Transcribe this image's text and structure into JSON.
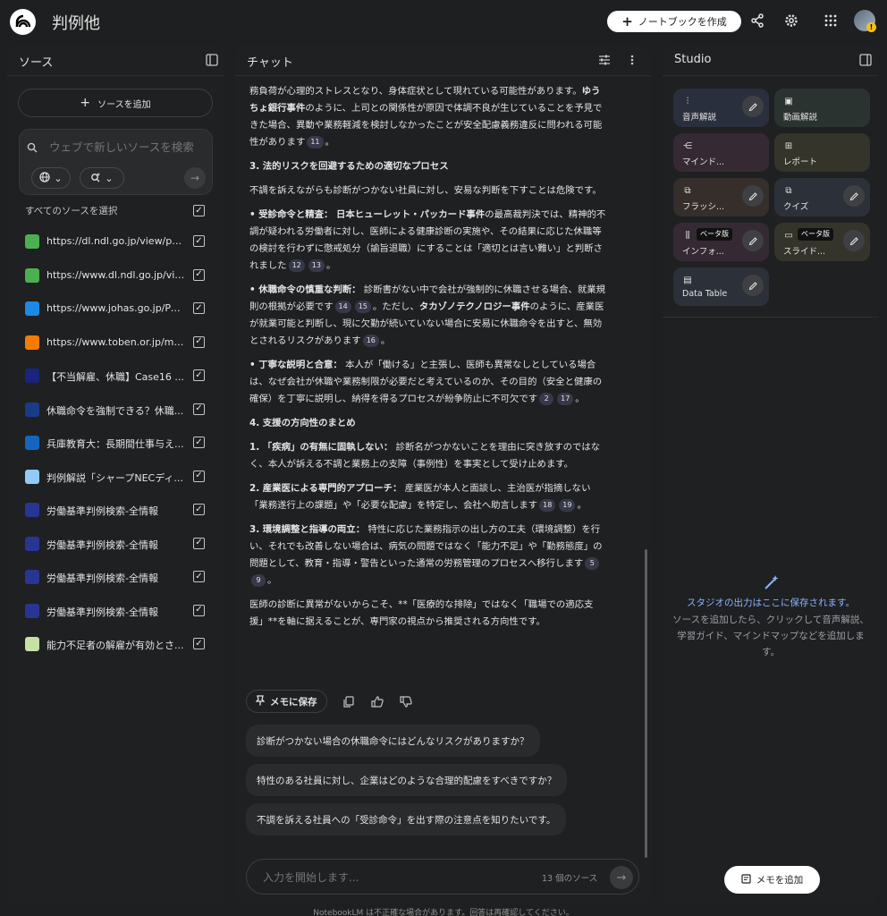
{
  "header": {
    "notebook_title": "判例他",
    "create_button": "ノートブックを作成",
    "share_icon": "share-icon",
    "settings_icon": "gear-icon",
    "apps_icon": "apps-grid-icon",
    "alert_badge": "!"
  },
  "sources_panel": {
    "title": "ソース",
    "add_source": "ソースを追加",
    "search_placeholder": "ウェブで新しいソースを検索",
    "select_all": "すべてのソースを選択",
    "items": [
      {
        "label": "https://dl.ndl.go.jp/view/prepa...",
        "icon": "ndl",
        "color": "#4caf50"
      },
      {
        "label": "https://www.dl.ndl.go.jp/view/...",
        "icon": "ndl",
        "color": "#4caf50"
      },
      {
        "label": "https://www.johas.go.jp/Porta...",
        "icon": "johas",
        "color": "#1e88e5"
      },
      {
        "label": "https://www.toben.or.jp/mess...",
        "icon": "toben",
        "color": "#f57c00"
      },
      {
        "label": "【不当解雇、休職】Case16 ...",
        "icon": "case",
        "color": "#1a237e"
      },
      {
        "label": "休職命令を強制できる？休職...",
        "icon": "ALG",
        "color": "#1a3a8a"
      },
      {
        "label": "兵庫教育大：長期間仕事与え...",
        "icon": "hyogo",
        "color": "#1565c0"
      },
      {
        "label": "判例解説「シャープNECディ...",
        "icon": "sharp",
        "color": "#90caf9"
      },
      {
        "label": "労働基準判例検索-全情報",
        "icon": "rodo",
        "color": "#283593"
      },
      {
        "label": "労働基準判例検索-全情報",
        "icon": "rodo",
        "color": "#283593"
      },
      {
        "label": "労働基準判例検索-全情報",
        "icon": "rodo",
        "color": "#283593"
      },
      {
        "label": "労働基準判例検索-全情報",
        "icon": "rodo",
        "color": "#283593"
      },
      {
        "label": "能力不足者の解雇が有効とさ...",
        "icon": "noryoku",
        "color": "#c5e1a5"
      }
    ]
  },
  "chat_panel": {
    "title": "チャット",
    "save_memo": "メモに保存",
    "input_placeholder": "入力を開始します...",
    "source_count": "13 個のソース",
    "suggestions": [
      "診断がつかない場合の休職命令にはどんなリスクがありますか？",
      "特性のある社員に対し、企業はどのような合理的配慮をすべきですか？",
      "不調を訴える社員への「受診命令」を出す際の注意点を知りたいです。"
    ]
  },
  "studio_panel": {
    "title": "Studio",
    "tiles": [
      {
        "label": "音声解説",
        "bg": "#2a2f3d"
      },
      {
        "label": "動画解説",
        "bg": "#2b3330"
      },
      {
        "label": "マインド...",
        "bg": "#352a33"
      },
      {
        "label": "レポート",
        "bg": "#35342a"
      },
      {
        "label": "フラッシ...",
        "bg": "#352e2a"
      },
      {
        "label": "クイズ",
        "bg": "#2c3038"
      },
      {
        "label": "インフォ...",
        "bg": "#352a33",
        "beta": "ベータ版"
      },
      {
        "label": "スライド...",
        "bg": "#35342a",
        "beta": "ベータ版"
      },
      {
        "label": "Data Table",
        "bg": "#2c3038"
      }
    ],
    "empty_title": "スタジオの出力はここに保存されます。",
    "empty_desc": "ソースを追加したら、クリックして音声解説、学習ガイド、マインドマップなどを追加します。",
    "add_memo": "メモを追加"
  },
  "footer": "NotebookLM は不正確な場合があります。回答は再確認してください。"
}
